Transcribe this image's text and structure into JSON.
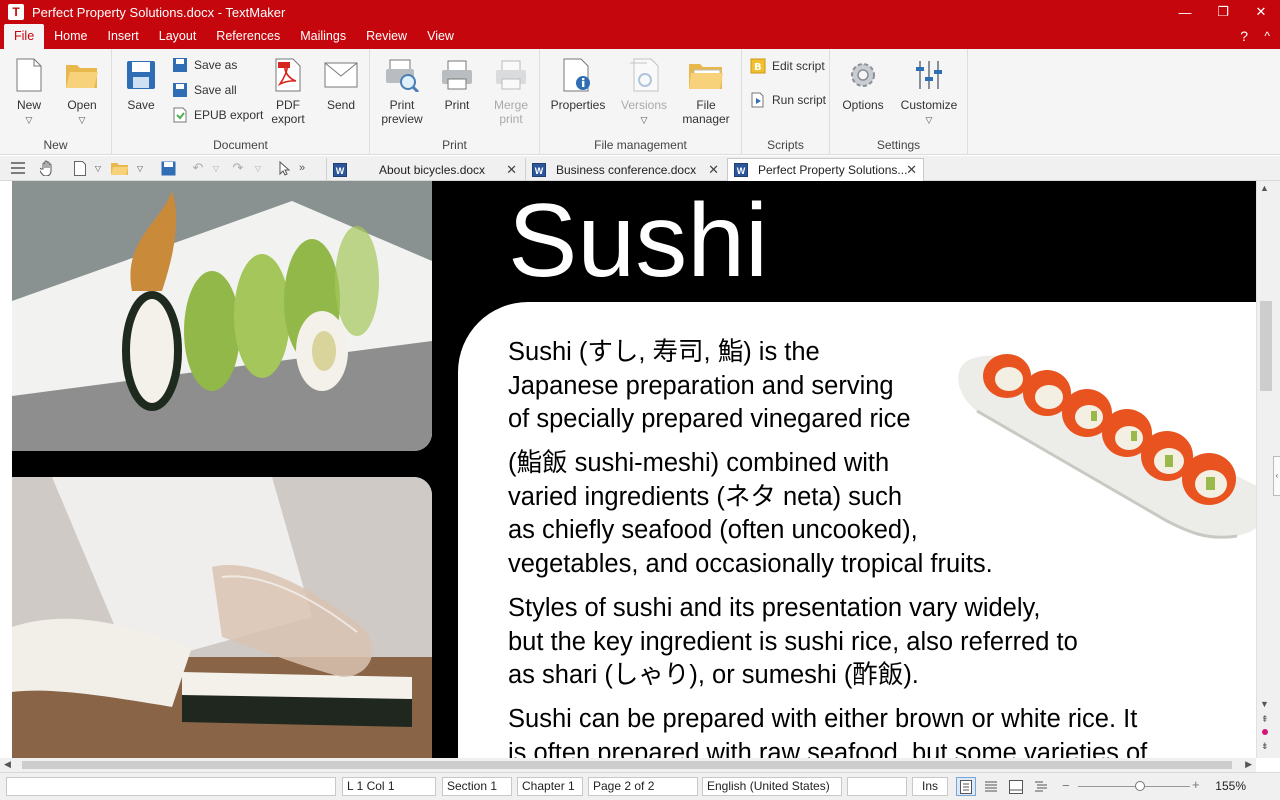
{
  "window": {
    "app_icon": "T",
    "title": "Perfect Property Solutions.docx - TextMaker",
    "controls": [
      "—",
      "❐",
      "✕"
    ]
  },
  "menu": {
    "items": [
      "File",
      "Home",
      "Insert",
      "Layout",
      "References",
      "Mailings",
      "Review",
      "View"
    ],
    "help": "?",
    "collapse": "^"
  },
  "ribbon": {
    "groups": {
      "new": "New",
      "document": "Document",
      "print": "Print",
      "file_management": "File management",
      "scripts": "Scripts",
      "settings": "Settings"
    },
    "buttons": {
      "new": "New",
      "open": "Open",
      "save": "Save",
      "save_as": "Save as",
      "save_all": "Save all",
      "epub_export": "EPUB export",
      "pdf_export_1": "PDF",
      "pdf_export_2": "export",
      "send": "Send",
      "print_preview_1": "Print",
      "print_preview_2": "preview",
      "print": "Print",
      "merge_print_1": "Merge",
      "merge_print_2": "print",
      "properties": "Properties",
      "versions": "Versions",
      "file_manager_1": "File",
      "file_manager_2": "manager",
      "edit_script": "Edit script",
      "run_script": "Run script",
      "options": "Options",
      "customize": "Customize"
    }
  },
  "tabs": [
    {
      "label": "About bicycles.docx"
    },
    {
      "label": "Business conference.docx"
    },
    {
      "label": "Perfect Property Solutions..."
    }
  ],
  "document": {
    "heading": "Sushi",
    "paragraphs": [
      [
        "Sushi (すし, 寿司, 鮨) is the",
        "Japanese preparation and serving",
        "of specially prepared vinegared rice"
      ],
      [
        "(鮨飯 sushi-meshi) combined with",
        "varied ingredients (ネタ neta) such",
        "as chiefly seafood (often uncooked),",
        "vegetables, and occasionally tropical fruits."
      ],
      [
        "Styles of sushi and its presentation vary widely,",
        "but the key ingredient is sushi rice, also referred to",
        "as shari (しゃり), or sumeshi (酢飯)."
      ],
      [
        "Sushi can be prepared with either brown or white rice. It",
        "is often prepared with raw seafood, but some varieties of"
      ]
    ]
  },
  "status": {
    "position": "L 1 Col 1",
    "section": "Section 1",
    "chapter": "Chapter 1",
    "page": "Page 2 of 2",
    "language": "English (United States)",
    "mode": "Ins",
    "zoom": "155%",
    "zoom_fraction": 0.55
  },
  "colors": {
    "brand": "#c5070d",
    "ribbon_bg": "#f5f5f5"
  }
}
